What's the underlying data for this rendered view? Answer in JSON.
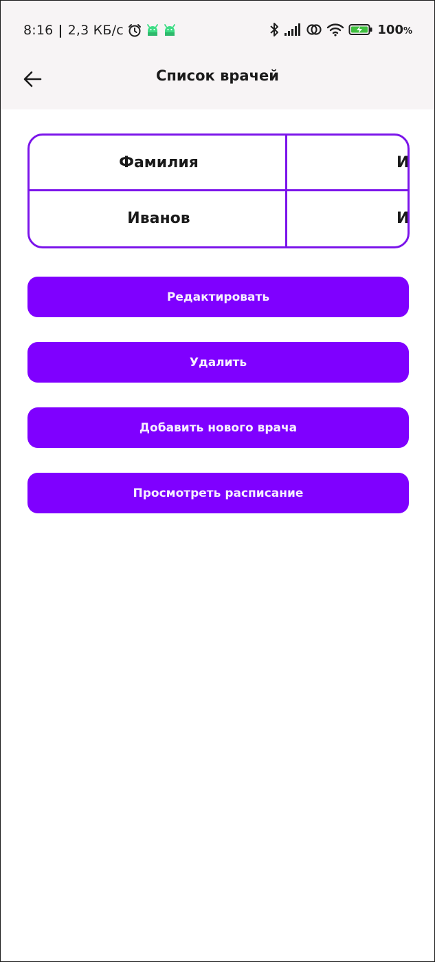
{
  "status_bar": {
    "time": "8:16",
    "separator": "|",
    "net_speed": "2,3 КБ/с",
    "battery_percent": "100",
    "battery_percent_sign": "%",
    "icons": [
      "alarm-icon",
      "android-icon",
      "android-icon",
      "bluetooth-icon",
      "signal-icon",
      "hotspot-icon",
      "wifi-icon",
      "battery-charging-icon"
    ],
    "colors": {
      "android": "#3ddc84",
      "battery": "#3fbf3f"
    }
  },
  "app_bar": {
    "title": "Список врачей",
    "back_icon": "arrow-back-icon"
  },
  "table": {
    "header": [
      "Фамилия",
      "И"
    ],
    "rows": [
      [
        "Иванов",
        "И"
      ]
    ]
  },
  "buttons": {
    "edit": "Редактировать",
    "delete": "Удалить",
    "add": "Добавить нового врача",
    "schedule": "Просмотреть расписание"
  },
  "colors": {
    "accent": "#7f00ff",
    "table_border": "#7b14ea",
    "top_background": "#f7f4f5"
  }
}
